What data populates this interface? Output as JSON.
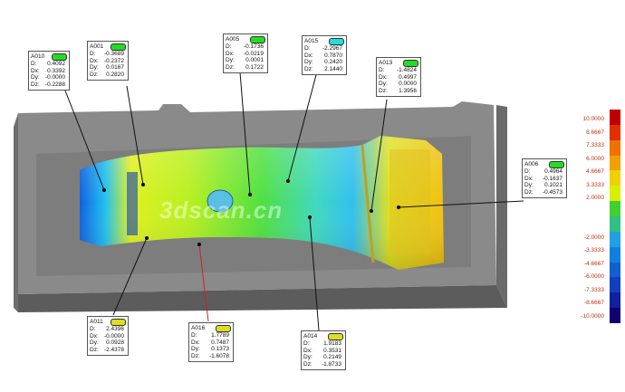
{
  "watermark": "3dscan.cn",
  "callouts": [
    {
      "id": "A010",
      "status": "green",
      "rows": [
        [
          "D:",
          "0.4092"
        ],
        [
          "Dx:",
          "0.3392"
        ],
        [
          "Dy:",
          "-0.0000"
        ],
        [
          "Dz:",
          "-0.2288"
        ]
      ]
    },
    {
      "id": "A001",
      "status": "green",
      "rows": [
        [
          "D:",
          "-0.3689"
        ],
        [
          "Dx:",
          "-0.2372"
        ],
        [
          "Dy:",
          "0.0167"
        ],
        [
          "Dz:",
          "0.2820"
        ]
      ]
    },
    {
      "id": "A005",
      "status": "green",
      "rows": [
        [
          "D:",
          "-0.1736"
        ],
        [
          "Dx:",
          "-0.0219"
        ],
        [
          "Dy:",
          "0.0001"
        ],
        [
          "Dz:",
          "0.1722"
        ]
      ]
    },
    {
      "id": "A015",
      "status": "cyan",
      "rows": [
        [
          "D:",
          "-2.2967"
        ],
        [
          "Dx:",
          "0.7870"
        ],
        [
          "Dy:",
          "0.2420"
        ],
        [
          "Dz:",
          "2.1440"
        ]
      ]
    },
    {
      "id": "A013",
      "status": "green",
      "rows": [
        [
          "D:",
          "-1.4824"
        ],
        [
          "Dx:",
          "0.4997"
        ],
        [
          "Dy:",
          "0.0000"
        ],
        [
          "Dz:",
          "1.3956"
        ]
      ]
    },
    {
      "id": "A006",
      "status": "green",
      "rows": [
        [
          "D:",
          "0.4964"
        ],
        [
          "Dx:",
          "-0.1637"
        ],
        [
          "Dy:",
          "0.1021"
        ],
        [
          "Dz:",
          "-0.4573"
        ]
      ]
    },
    {
      "id": "A011",
      "status": "yellow",
      "rows": [
        [
          "D:",
          "2.4396"
        ],
        [
          "Dx:",
          "-0.0000"
        ],
        [
          "Dy:",
          "0.0928"
        ],
        [
          "Dz:",
          "-2.4378"
        ]
      ]
    },
    {
      "id": "A016",
      "status": "yellow",
      "rows": [
        [
          "D:",
          "1.7789"
        ],
        [
          "Dx:",
          "0.7487"
        ],
        [
          "Dy:",
          "0.1373"
        ],
        [
          "Dz:",
          "-1.6078"
        ]
      ]
    },
    {
      "id": "A014",
      "status": "yellow",
      "rows": [
        [
          "D:",
          "1.9183"
        ],
        [
          "Dx:",
          "0.3531"
        ],
        [
          "Dy:",
          "0.2149"
        ],
        [
          "Dz:",
          "-1.8733"
        ]
      ]
    }
  ],
  "legend": {
    "ticks": [
      "10.0000",
      "8.6667",
      "7.3333",
      "6.0000",
      "4.6667",
      "3.3333",
      "2.0000",
      "-2.0000",
      "-3.3333",
      "-4.6667",
      "-6.0000",
      "-7.3333",
      "-8.6667",
      "-10.0000"
    ],
    "colors": [
      "#c00000",
      "#e03000",
      "#f07000",
      "#f0a000",
      "#f0d000",
      "#d8f000",
      "#40d030",
      "#30c080",
      "#20a0e0",
      "#1080e0",
      "#1060d0",
      "#1040c0",
      "#1020a0",
      "#100070"
    ]
  },
  "status_colors": {
    "green": "#22dd22",
    "cyan": "#22dddd",
    "yellow": "#dddd22"
  }
}
